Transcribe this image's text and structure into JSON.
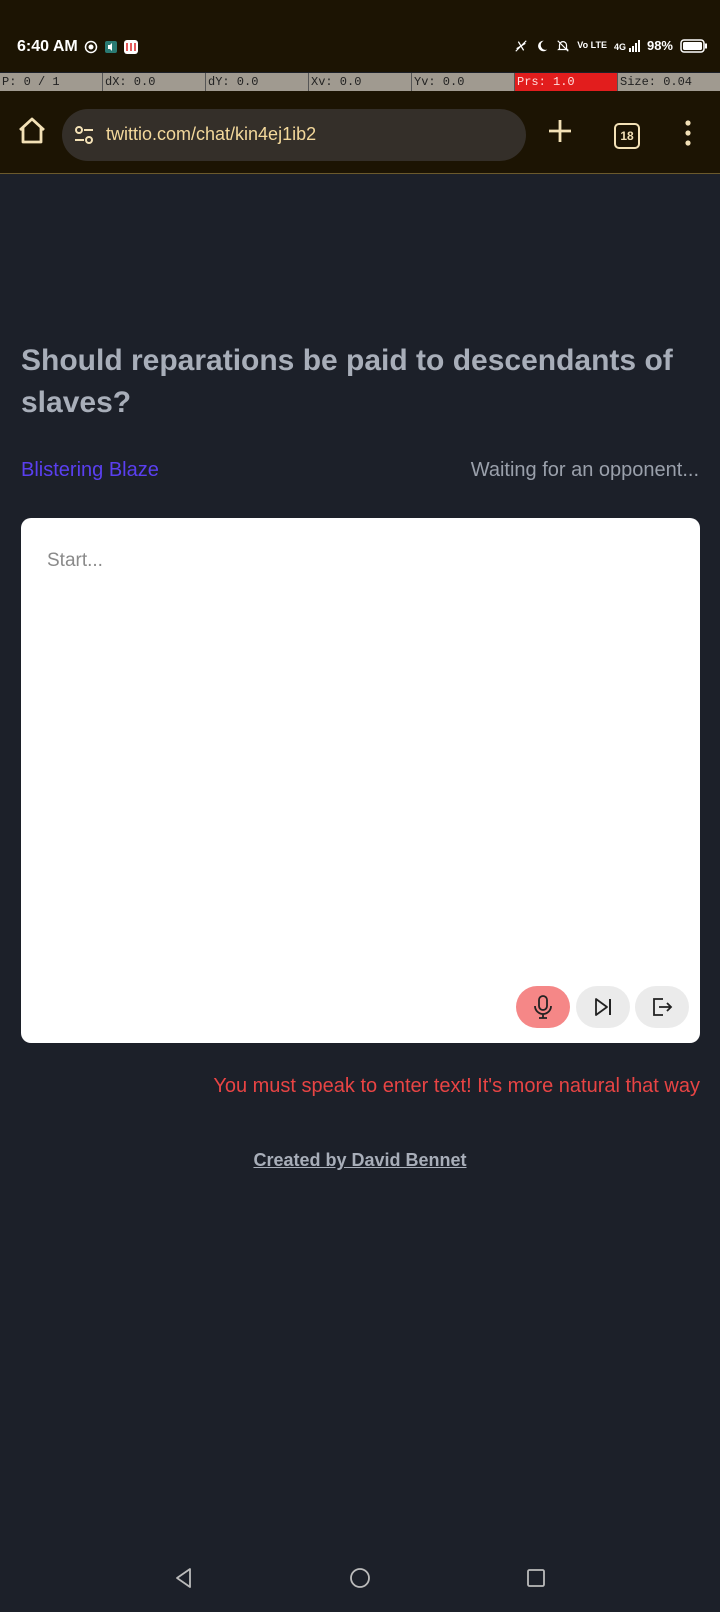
{
  "status_bar": {
    "time": "6:40 AM",
    "battery": "98%",
    "network": "4G",
    "volte": "Vo LTE"
  },
  "pointer_overlay": {
    "p": "P: 0 / 1",
    "dx": "dX: 0.0",
    "dy": "dY: 0.0",
    "xv": "Xv: 0.0",
    "yv": "Yv: 0.0",
    "prs": "Prs: 1.0",
    "size": "Size: 0.04"
  },
  "browser": {
    "url": "twittio.com/chat/kin4ej1ib2",
    "tab_count": "18",
    "icons": {
      "home": "home-icon",
      "site_settings": "tune-icon",
      "new_tab": "plus-icon",
      "tabs": "tab-switcher-icon",
      "menu": "more-vertical-icon"
    }
  },
  "page": {
    "question": "Should reparations be paid to descendants of slaves?",
    "player_name": "Blistering Blaze",
    "opponent_status": "Waiting for an opponent...",
    "editor_placeholder": "Start...",
    "hint": "You must speak to enter text! It's more natural that way",
    "credit": "Created by David Bennet",
    "colors": {
      "background": "#1c2029",
      "player": "#5a3ff0",
      "hint": "#e84444",
      "mic_button": "#f58787"
    }
  },
  "navigation": {
    "back": "back-triangle-icon",
    "home": "home-circle-icon",
    "recents": "recents-square-icon"
  }
}
